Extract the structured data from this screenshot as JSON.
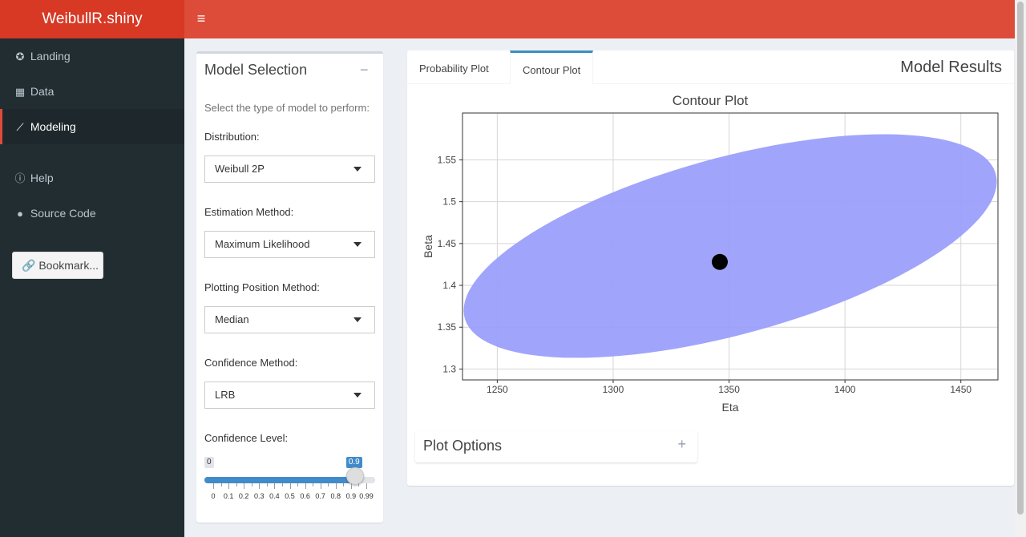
{
  "app": {
    "logo": "WeibullR.shiny",
    "menu_icon": "≡"
  },
  "sidebar": {
    "items": [
      {
        "label": "Landing",
        "icon": "rocket-icon"
      },
      {
        "label": "Data",
        "icon": "table-icon"
      },
      {
        "label": "Modeling",
        "icon": "line-chart-icon",
        "active": true
      },
      {
        "label": "Help",
        "icon": "info-circle-icon"
      },
      {
        "label": "Source Code",
        "icon": "github-icon"
      }
    ],
    "bookmark_label": "Bookmark..."
  },
  "model_selection": {
    "title": "Model Selection",
    "collapse_symbol": "−",
    "help": "Select the type of model to perform:",
    "distribution": {
      "label": "Distribution:",
      "value": "Weibull 2P"
    },
    "estimation": {
      "label": "Estimation Method:",
      "value": "Maximum Likelihood"
    },
    "plotting_position": {
      "label": "Plotting Position Method:",
      "value": "Median"
    },
    "confidence_method": {
      "label": "Confidence Method:",
      "value": "LRB"
    },
    "confidence_level": {
      "label": "Confidence Level:",
      "min_label": "0",
      "value_label": "0.9",
      "value": 0.9,
      "min": 0,
      "max": 0.99,
      "ticks": [
        "0",
        "0.1",
        "0.2",
        "0.3",
        "0.4",
        "0.5",
        "0.6",
        "0.7",
        "0.8",
        "0.9",
        "0.99"
      ]
    }
  },
  "results": {
    "title": "Model Results",
    "tabs": [
      {
        "label": "Probability Plot",
        "active": false
      },
      {
        "label": "Contour Plot",
        "active": true
      }
    ],
    "plot_options": {
      "title": "Plot Options",
      "expand_symbol": "+"
    }
  },
  "colors": {
    "header": "#dd4b39",
    "logo_bg": "#d73925",
    "sidebar": "#222d32",
    "contour_fill": "#9b9ffb",
    "accent": "#3c8dbc"
  },
  "chart_data": {
    "type": "scatter",
    "title": "Contour Plot",
    "xlabel": "Eta",
    "ylabel": "Beta",
    "xlim": [
      1235,
      1466
    ],
    "ylim": [
      1.287,
      1.606
    ],
    "xticks": [
      1250,
      1300,
      1350,
      1400,
      1450
    ],
    "yticks": [
      1.3,
      1.35,
      1.4,
      1.45,
      1.5,
      1.55
    ],
    "grid": true,
    "series": [
      {
        "kind": "contour-region",
        "center": [
          1350.5,
          1.447
        ],
        "eta_range": [
          1235,
          1465
        ],
        "beta_range": [
          1.295,
          1.575
        ],
        "color": "#9b9ffb"
      },
      {
        "kind": "point-estimate",
        "x": 1346,
        "y": 1.428,
        "color": "#000000"
      }
    ]
  }
}
